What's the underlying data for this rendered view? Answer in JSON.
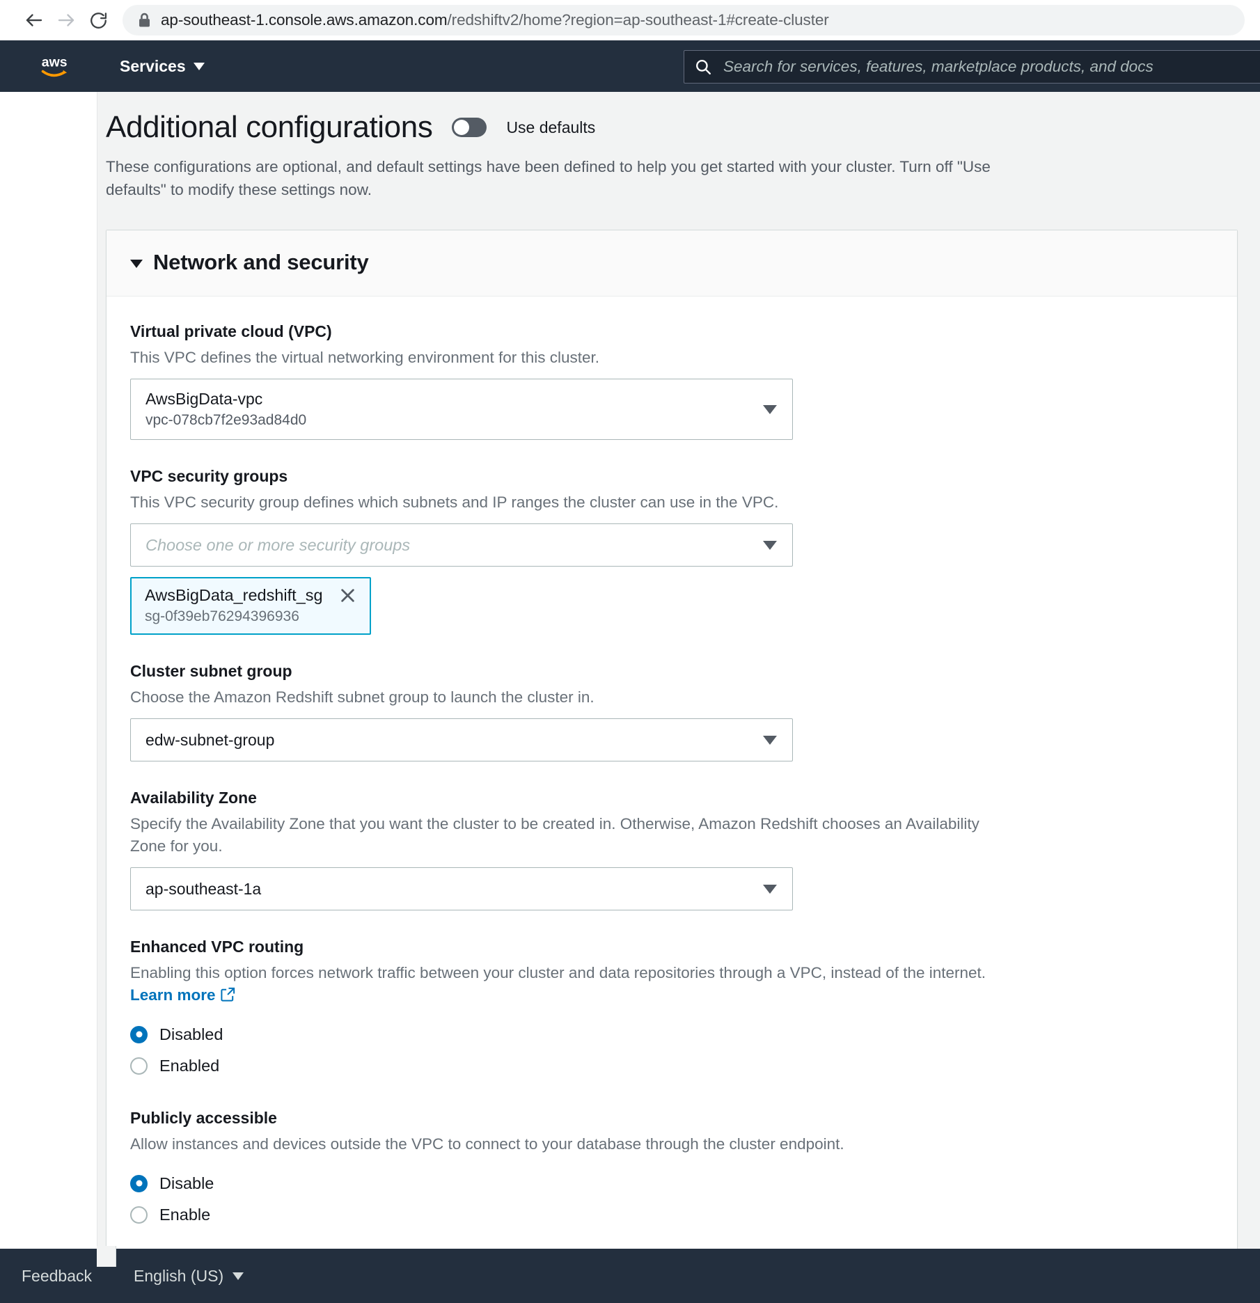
{
  "browser": {
    "url_prefix": "ap-southeast-1.console.aws.amazon.com",
    "url_suffix": "/redshiftv2/home?region=ap-southeast-1#create-cluster",
    "back_icon": "back-arrow-icon",
    "forward_icon": "forward-arrow-icon",
    "reload_icon": "reload-icon",
    "lock_icon": "lock-icon"
  },
  "topnav": {
    "logo": "aws-logo",
    "services_label": "Services",
    "search_placeholder": "Search for services, features, marketplace products, and docs",
    "search_icon": "search-icon"
  },
  "page": {
    "title": "Additional configurations",
    "use_defaults_label": "Use defaults",
    "use_defaults_on": false,
    "description": "These configurations are optional, and default settings have been defined to help you get started with your cluster. Turn off \"Use defaults\" to modify these settings now."
  },
  "section": {
    "title": "Network and security",
    "expanded": true,
    "fields": {
      "vpc": {
        "label": "Virtual private cloud (VPC)",
        "description": "This VPC defines the virtual networking environment for this cluster.",
        "value": "AwsBigData-vpc",
        "value_id": "vpc-078cb7f2e93ad84d0"
      },
      "security_groups": {
        "label": "VPC security groups",
        "description": "This VPC security group defines which subnets and IP ranges the cluster can use in the VPC.",
        "placeholder": "Choose one or more security groups",
        "tokens": [
          {
            "name": "AwsBigData_redshift_sg",
            "id": "sg-0f39eb76294396936"
          }
        ]
      },
      "subnet_group": {
        "label": "Cluster subnet group",
        "description": "Choose the Amazon Redshift subnet group to launch the cluster in.",
        "value": "edw-subnet-group"
      },
      "availability_zone": {
        "label": "Availability Zone",
        "description": "Specify the Availability Zone that you want the cluster to be created in. Otherwise, Amazon Redshift chooses an Availability Zone for you.",
        "value": "ap-southeast-1a"
      },
      "enhanced_vpc_routing": {
        "label": "Enhanced VPC routing",
        "description_part1": "Enabling this option forces network traffic between your cluster and data repositories through a VPC, instead of the internet.",
        "learn_more_label": "Learn more",
        "options": [
          {
            "label": "Disabled",
            "selected": true
          },
          {
            "label": "Enabled",
            "selected": false
          }
        ]
      },
      "publicly_accessible": {
        "label": "Publicly accessible",
        "description": "Allow instances and devices outside the VPC to connect to your database through the cluster endpoint.",
        "options": [
          {
            "label": "Disable",
            "selected": true
          },
          {
            "label": "Enable",
            "selected": false
          }
        ]
      }
    }
  },
  "footer": {
    "feedback_label": "Feedback",
    "language_label": "English (US)"
  },
  "colors": {
    "accent_blue": "#0073bb",
    "token_border": "#00a1c9",
    "nav_dark": "#232f3e",
    "page_bg": "#f2f3f3"
  }
}
